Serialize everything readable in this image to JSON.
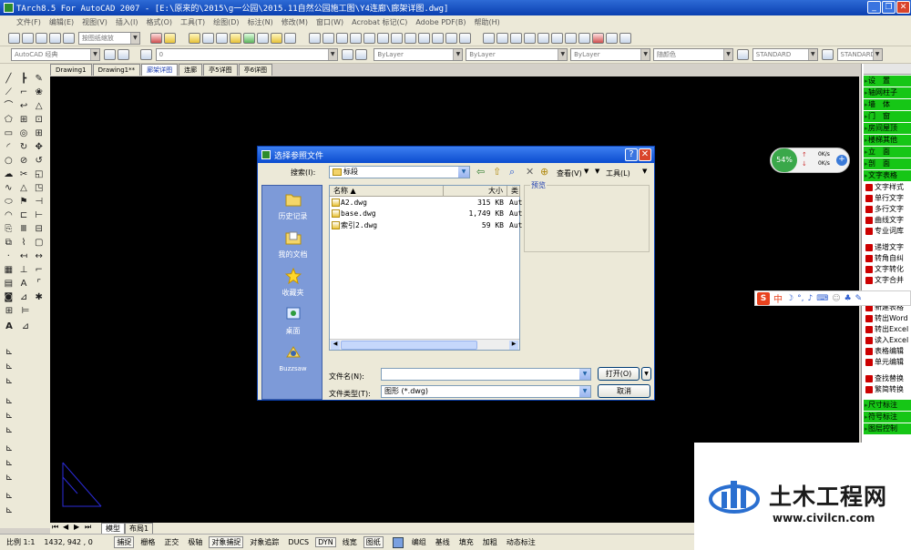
{
  "window": {
    "title": "TArch8.5 For AutoCAD 2007 - [E:\\原来的\\2015\\g一公园\\2015.11自然公园施工图\\Y4连廊\\廊架详图.dwg]"
  },
  "menu": [
    "文件(F)",
    "编辑(E)",
    "视图(V)",
    "插入(I)",
    "格式(O)",
    "工具(T)",
    "绘图(D)",
    "标注(N)",
    "修改(M)",
    "窗口(W)",
    "Acrobat 标记(C)",
    "Adobe PDF(B)",
    "帮助(H)"
  ],
  "toolbar": {
    "view_combo": "按图纸缩放",
    "workspace": "AutoCAD 经典",
    "layer_combo": "0",
    "color": "ByLayer",
    "linetype": "ByLayer",
    "lineweight": "ByLayer",
    "plotstyle": "随颜色",
    "textstyle": "STANDARD",
    "dimstyle": "STANDARD"
  },
  "tabs": [
    "Drawing1",
    "Drawing1**",
    "廊架详图",
    "连廊",
    "亭5详图",
    "亭6详图"
  ],
  "right_panel": {
    "green_a": [
      "设　置",
      "轴网柱子",
      "墙　体",
      "门　窗",
      "房间屋顶",
      "楼梯其他",
      "立　面",
      "剖　面",
      "文字表格"
    ],
    "text_tools": [
      "文字样式",
      "单行文字",
      "多行文字",
      "曲线文字",
      "专业词库",
      "递增文字",
      "转角自纠",
      "文字转化",
      "文字合并"
    ],
    "table_tools": [
      "新建表格",
      "转出Word",
      "转出Excel",
      "读入Excel",
      "表格编辑",
      "单元编辑",
      "查找替换",
      "繁简转换"
    ],
    "green_b": [
      "尺寸标注",
      "符号标注",
      "图层控制"
    ]
  },
  "net_widget": {
    "percent": "54%",
    "up": "0K/s",
    "down": "0K/s"
  },
  "ime": {
    "label": "中"
  },
  "dialog": {
    "title": "选择参照文件",
    "search_label": "搜索(I):",
    "folder": "标段",
    "view_label": "查看(V)",
    "tools_label": "工具(L)",
    "preview_label": "预览",
    "columns": [
      "名称",
      "大小",
      "类"
    ],
    "files": [
      {
        "name": "A2.dwg",
        "size": "315 KB",
        "type": "Aut"
      },
      {
        "name": "base.dwg",
        "size": "1,749 KB",
        "type": "Aut"
      },
      {
        "name": "索引2.dwg",
        "size": "59 KB",
        "type": "Aut"
      }
    ],
    "places": [
      "历史记录",
      "我的文档",
      "收藏夹",
      "桌面",
      "Buzzsaw"
    ],
    "filename_label": "文件名(N):",
    "filename_value": "",
    "filetype_label": "文件类型(T):",
    "filetype_value": "图形 (*.dwg)",
    "open_button": "打开(O)",
    "cancel_button": "取消"
  },
  "layout_tabs": [
    "模型",
    "布局1"
  ],
  "status": {
    "scale": "比例 1:1",
    "coords": "1432,  942 , 0",
    "toggles": [
      "捕捉",
      "栅格",
      "正交",
      "极轴",
      "对象捕捉",
      "对象追踪",
      "DUCS",
      "DYN",
      "线宽",
      "图纸"
    ],
    "right": [
      "编组",
      "基线",
      "填充",
      "加粗",
      "动态标注"
    ]
  },
  "watermark": {
    "brand": "土木工程网",
    "url": "www.civilcn.com"
  },
  "colors": {
    "title": "#0a3fb0",
    "canvas": "#000000",
    "panel_green": "#16c616"
  }
}
